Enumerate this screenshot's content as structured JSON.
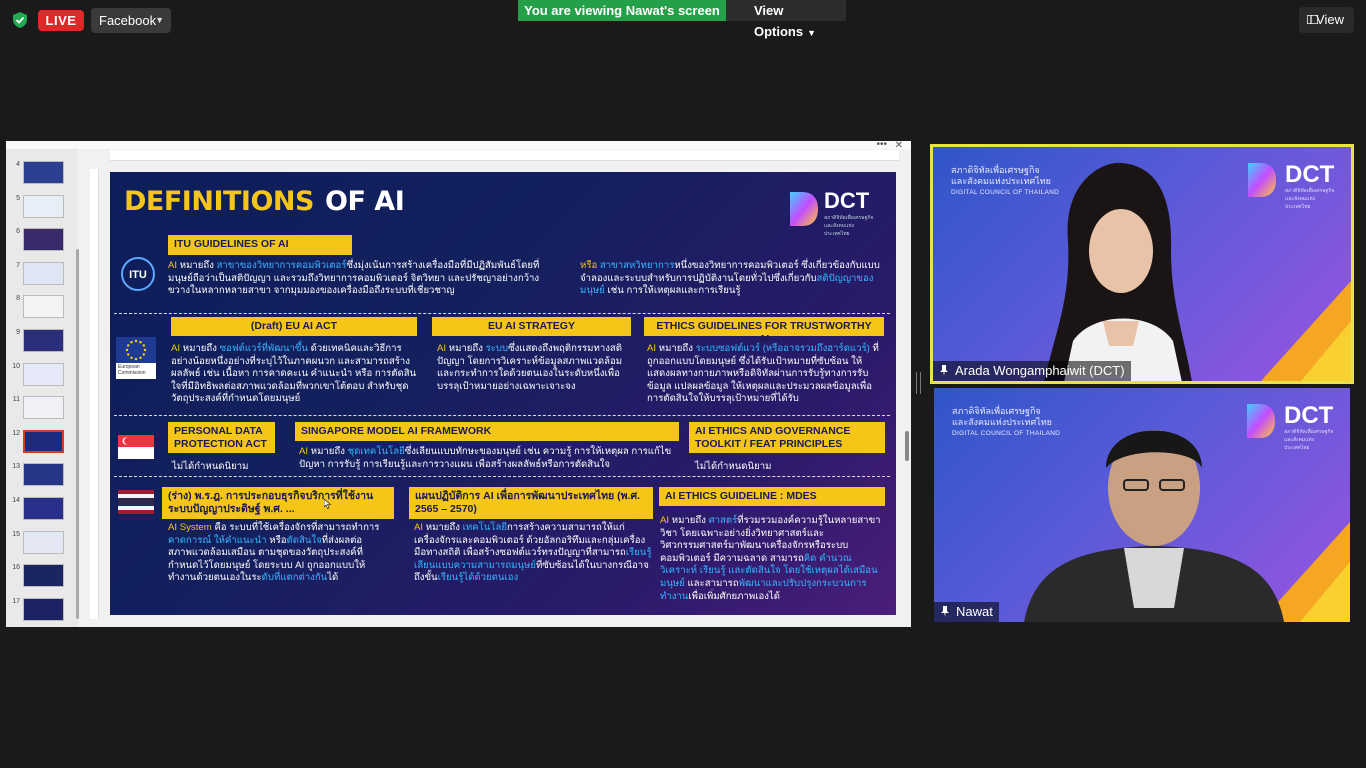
{
  "topbar": {
    "shield_icon": "shield-check-icon",
    "live_label": "LIVE",
    "platform_label": "Facebook",
    "viewing_banner": "You are viewing Nawat's screen",
    "view_options_label": "View Options",
    "view_label": "View"
  },
  "thumbnails": {
    "numbers": [
      "4",
      "5",
      "6",
      "7",
      "8",
      "9",
      "10",
      "11",
      "12",
      "13",
      "14",
      "15",
      "16",
      "17"
    ],
    "active": "12"
  },
  "slide": {
    "title_part1": "DEFINITIONS",
    "title_part2": "OF AI",
    "logo_text": "DCT",
    "logo_sub": "สภาดิจิทัลเพื่อเศรษฐกิจและสังคมแห่งประเทศไทย",
    "eu_caption": "European Commission",
    "itu": {
      "header": "ITU GUIDELINES OF AI",
      "left_a": "AI",
      "left_b": " หมายถึง ",
      "left_c": "สาขาของวิทยาการคอมพิวเตอร์",
      "left_d": "ซึ่งมุ่งเน้นการสร้างเครื่องมือที่มีปฏิสัมพันธ์โดยที่มนุษย์ถือว่าเป็นสติปัญญา และรวมถึงวิทยาการคอมพิวเตอร์ จิตวิทยา และปรัชญาอย่างกว้างขวางในหลากหลายสาขา จากมุมมองของเครื่องมือถึงระบบที่เชี่ยวชาญ",
      "right_a": "หรือ ",
      "right_b": "สาขาสหวิทยาการ",
      "right_c": "หนึ่งของวิทยาการคอมพิวเตอร์ ซึ่งเกี่ยวข้องกับแบบจำลองและระบบสำหรับการปฏิบัติงานโดยทั่วไปซึ่งเกี่ยวกับ",
      "right_d": "สติปัญญาของมนุษย์",
      "right_e": " เช่น การให้เหตุผลและการเรียนรู้"
    },
    "eu_act": {
      "header": "(Draft) EU AI ACT",
      "a": "AI",
      "b": " หมายถึง ",
      "c": "ซอฟต์แวร์ที่พัฒนาขึ้น",
      "d": " ด้วยเทคนิคและวิธีการอย่างน้อยหนึ่งอย่างที่ระบุไว้ในภาคผนวก และสามารถสร้างผลลัพธ์ เช่น เนื้อหา การคาดคะเน คำแนะนำ หรือ การตัดสินใจที่มีอิทธิพลต่อสภาพแวดล้อมที่พวกเขาโต้ตอบ สำหรับชุดวัตถุประสงค์ที่กำหนดโดยมนุษย์"
    },
    "eu_strategy": {
      "header": "EU AI STRATEGY",
      "a": "AI",
      "b": " หมายถึง ",
      "c": "ระบบ",
      "d": "ซึ่งแสดงถึงพฤติกรรมทางสติปัญญา โดยการวิเคราะห์ข้อมูลสภาพแวดล้อมและกระทำการใดด้วยตนเองในระดับหนึ่งเพื่อบรรลุเป้าหมายอย่างเฉพาะเจาะจง"
    },
    "ethics_trust": {
      "header": "ETHICS GUIDELINES FOR TRUSTWORTHY AI",
      "a": "AI",
      "b": " หมายถึง ",
      "c": "ระบบซอฟต์แวร์ (หรืออาจรวมถึงฮาร์ดแวร์)",
      "d": " ที่ถูกออกแบบโดยมนุษย์ ซึ่งได้รับเป้าหมายที่ซับซ้อน ให้แสดงผลทางกายภาพหรือดิจิทัลผ่านการรับรู้ทางการรับข้อมูล แปลผลข้อมูล ให้เหตุผลและประมวลผลข้อมูลเพื่อการตัดสินใจให้บรรลุเป้าหมายที่ได้รับ"
    },
    "pdpa": {
      "header": "PERSONAL DATA PROTECTION ACT",
      "body": "ไม่ได้กำหนดนิยาม"
    },
    "sg_model": {
      "header": "SINGAPORE MODEL AI FRAMEWORK",
      "a": "AI",
      "b": " หมายถึง ",
      "c": "ชุดเทคโนโลยี",
      "d": "ซึ่งเลียนแบบทักษะของมนุษย์ เช่น ความรู้ การให้เหตุผล การแก้ไขปัญหา การรับรู้ การเรียนรู้และการวางแผน เพื่อสร้างผลลัพธ์หรือการตัดสินใจ"
    },
    "feat": {
      "header": "AI ETHICS AND GOVERNANCE TOOLKIT / FEAT PRINCIPLES",
      "body": "ไม่ได้กำหนดนิยาม"
    },
    "th_decree": {
      "header": "(ร่าง) พ.ร.ฎ. การประกอบธุรกิจบริการที่ใช้งานระบบปัญญาประดิษฐ์ พ.ศ. ...",
      "a": "AI System",
      "b": " คือ ระบบที่ใช้เครื่องจักรที่สามารถทำการ",
      "c": "คาดการณ์ ให้คำแนะนำ",
      "d": " หรือ",
      "e": "ตัดสินใจ",
      "f": "ที่ส่งผลต่อสภาพแวดล้อมเสมือน ตามชุดของวัตถุประสงค์ที่กำหนดไว้โดยมนุษย์ โดยระบบ AI ถูกออกแบบให้ทำงานด้วยตนเองในระ",
      "g": "ดับที่แตกต่างกัน",
      "h": "ได้"
    },
    "th_plan": {
      "header": "แผนปฏิบัติการ AI เพื่อการพัฒนาประเทศไทย (พ.ศ. 2565 – 2570)",
      "a": "AI",
      "b": " หมายถึง ",
      "c": "เทคโนโลยี",
      "d": "การสร้างความสามารถให้แก่เครื่องจักรและคอมพิวเตอร์ ด้วยอัลกอริทึมและกลุ่มเครื่องมือทางสถิติ เพื่อสร้างซอฟต์แวร์ทรงปัญญาที่สามารถ",
      "e": "เรียนรู้ เลียนแบบความสามารถมนุษย์",
      "f": "ที่ซับซ้อนได้ในบางกรณีอาจถึงขั้น",
      "g": "เรียนรู้ได้ด้วยตนเอง"
    },
    "mdes": {
      "header": "AI ETHICS GUIDELINE : MDES",
      "a": "AI",
      "b": " หมายถึง ",
      "c": "ศาสตร์",
      "d": "ที่รวมรวมองค์ความรู้ในหลายสาขาวิชา โดยเฉพาะอย่างยิ่งวิทยาศาสตร์และวิศวกรรมศาสตร์มาพัฒนาเครื่องจักรหรือระบบคอมพิวเตอร์ มีความฉลาด สามารถ",
      "e": "คิด คำนวณ วิเคราะห์ เรียนรู้ และตัดสินใจ โดยใช้เหตุผลได้เสมือนมนุษย์",
      "f": " และสามารถ",
      "g": "พัฒนาและปรับปรุงกระบวนการทำงาน",
      "h": "เพื่อเพิ่มศักยภาพเองได้"
    }
  },
  "videos": {
    "tile_org_th_1": "สภาดิจิทัลเพื่อเศรษฐกิจ",
    "tile_org_th_2": "และสังคมแห่งประเทศไทย",
    "tile_org_en": "DIGITAL COUNCIL OF THAILAND",
    "tile_logo": "DCT",
    "tile_logo_sub": "สภาดิจิทัลเพื่อเศรษฐกิจและสังคมแห่งประเทศไทย",
    "participant1": "Arada Wongamphaiwit (DCT)",
    "participant2": "Nawat",
    "colors": {
      "active_speaker_border": "#e8e34a",
      "live": "#e02828",
      "viewing": "#24a148"
    }
  }
}
